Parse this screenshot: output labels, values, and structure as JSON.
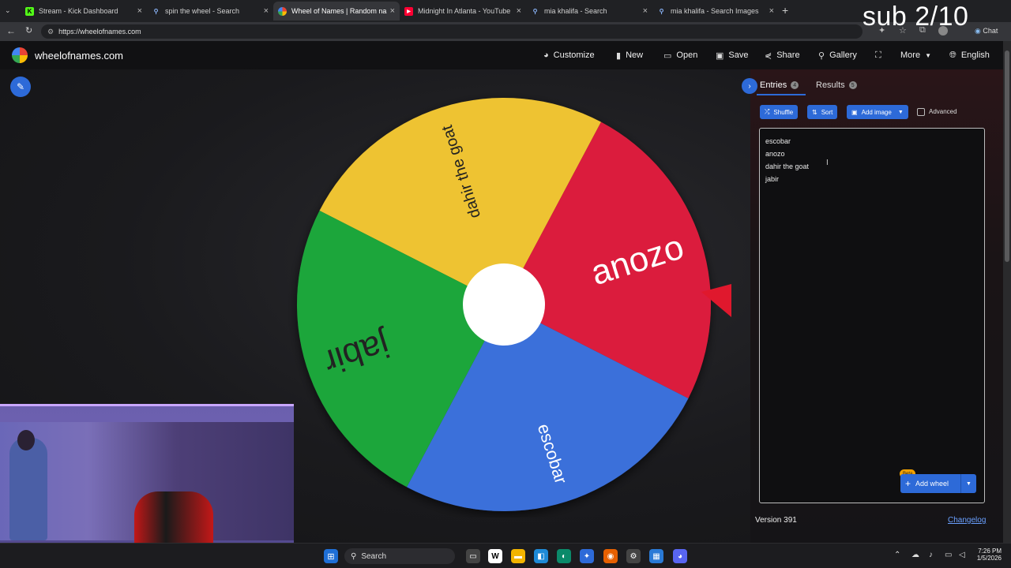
{
  "browser": {
    "tabs": [
      {
        "title": "Stream - Kick Dashboard",
        "icon": "kick-icon",
        "color": "#53fc18"
      },
      {
        "title": "spin the wheel - Search",
        "icon": "search-icon",
        "color": "#3b82f6"
      },
      {
        "title": "Wheel of Names | Random name p",
        "icon": "wheel-icon",
        "color": "#ea4335"
      },
      {
        "title": "Midnight In Atlanta - YouTube",
        "icon": "youtube-icon",
        "color": "#ff0033"
      },
      {
        "title": "mia khalifa - Search",
        "icon": "search-icon",
        "color": "#3b82f6"
      },
      {
        "title": "mia khalifa - Search Images",
        "icon": "search-icon",
        "color": "#3b82f6"
      }
    ],
    "url": "https://wheelofnames.com",
    "chat_label": "Chat"
  },
  "overlay_text": "sub 2/10",
  "app": {
    "brand": "wheelofnames.com",
    "nav": {
      "customize": "Customize",
      "new": "New",
      "open": "Open",
      "save": "Save",
      "share": "Share",
      "gallery": "Gallery",
      "more": "More",
      "language": "English"
    }
  },
  "wheel": {
    "segments": [
      {
        "label": "dahir the goat",
        "color": "#eec331"
      },
      {
        "label": "anozo",
        "color": "#db1f3c"
      },
      {
        "label": "escobar",
        "color": "#3a6fda"
      },
      {
        "label": "jabir",
        "color": "#1fa63a"
      }
    ],
    "pointer_color": "#e0182d",
    "center_color": "#ffffff"
  },
  "panel": {
    "tabs": {
      "entries_label": "Entries",
      "entries_count": "4",
      "results_label": "Results",
      "results_count": "5"
    },
    "toolbar": {
      "shuffle": "Shuffle",
      "sort": "Sort",
      "add_image": "Add image",
      "advanced": "Advanced"
    },
    "entries": [
      "escobar",
      "anozo",
      "dahir the goat",
      "jabir"
    ],
    "beta_badge": "Beta",
    "add_wheel": "Add wheel",
    "version": "Version 391",
    "changelog": "Changelog"
  },
  "taskbar": {
    "search_label": "Search",
    "time": "7:26 PM",
    "date": "1/5/2026"
  }
}
